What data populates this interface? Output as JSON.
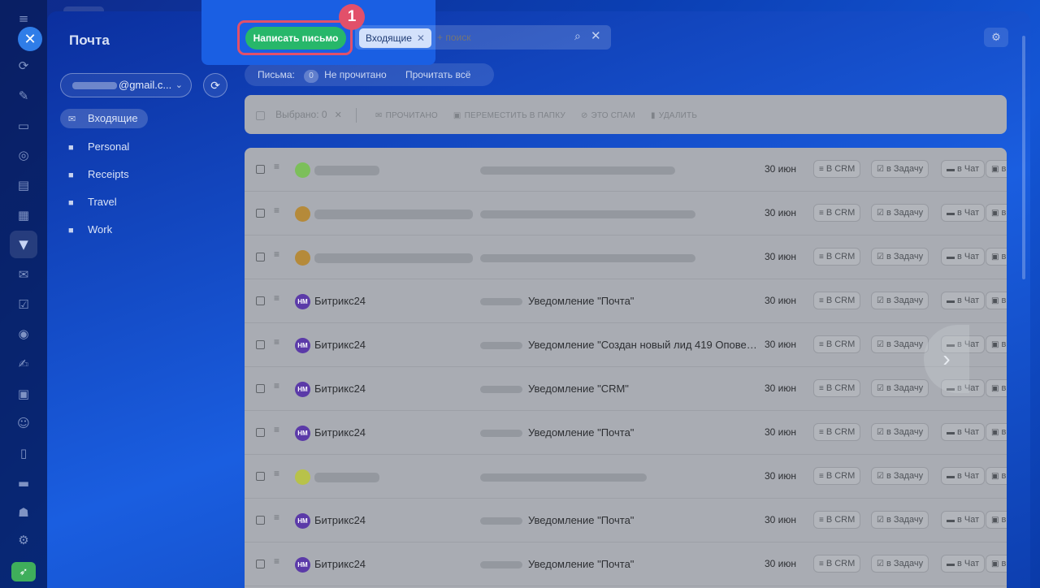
{
  "window": {
    "title": "Почта"
  },
  "toolbar": {
    "compose_label": "Написать письмо",
    "step_number": "1",
    "search_tag": "Входящие",
    "search_placeholder": "+ поиск"
  },
  "account": {
    "email_suffix": "@gmail.c..."
  },
  "folders": [
    {
      "label": "Входящие",
      "active": true
    },
    {
      "label": "Personal"
    },
    {
      "label": "Receipts"
    },
    {
      "label": "Travel"
    },
    {
      "label": "Work"
    }
  ],
  "filter_bar": {
    "letters_label": "Письма:",
    "unread_count": "0",
    "unread_label": "Не прочитано",
    "read_all_label": "Прочитать всё"
  },
  "action_bar": {
    "selected_label": "Выбрано: 0",
    "actions": [
      "ПРОЧИТАНО",
      "ПЕРЕМЕСТИТЬ В ПАПКУ",
      "ЭТО СПАМ",
      "УДАЛИТЬ"
    ]
  },
  "row_actions": {
    "crm": "В CRM",
    "task": "в Задачу",
    "chat": "в Чат",
    "more": "в"
  },
  "messages": [
    {
      "sender": "",
      "subject": "",
      "date": "30 июн",
      "avatar_color": "#7cbf5a",
      "blurred": true
    },
    {
      "sender": "",
      "subject": "",
      "date": "30 июн",
      "avatar_color": "#b58a3a",
      "blurred": true
    },
    {
      "sender": "",
      "subject": "",
      "date": "30 июн",
      "avatar_color": "#b58a3a",
      "blurred": true
    },
    {
      "sender": "Битрикс24",
      "subject": "Уведомление \"Почта\"",
      "date": "30 июн",
      "avatar": "НМ",
      "avatar_color": "#5b3aa8"
    },
    {
      "sender": "Битрикс24",
      "subject": "Уведомление \"Создан новый лид 419 Оповещен...",
      "date": "30 июн",
      "avatar": "НМ",
      "avatar_color": "#5b3aa8"
    },
    {
      "sender": "Битрикс24",
      "subject": "Уведомление \"CRM\"",
      "date": "30 июн",
      "avatar": "НМ",
      "avatar_color": "#5b3aa8"
    },
    {
      "sender": "Битрикс24",
      "subject": "Уведомление \"Почта\"",
      "date": "30 июн",
      "avatar": "НМ",
      "avatar_color": "#5b3aa8"
    },
    {
      "sender": "",
      "subject": "",
      "date": "30 июн",
      "avatar_color": "#b8c24a",
      "blurred": true
    },
    {
      "sender": "Битрикс24",
      "subject": "Уведомление \"Почта\"",
      "date": "30 июн",
      "avatar": "НМ",
      "avatar_color": "#5b3aa8"
    },
    {
      "sender": "Битрикс24",
      "subject": "Уведомление \"Почта\"",
      "date": "30 июн",
      "avatar": "НМ",
      "avatar_color": "#5b3aa8"
    }
  ],
  "colors": {
    "accent_green": "#27b76a",
    "highlight_red": "#e2506a",
    "brand_blue": "#1a5fe3"
  }
}
